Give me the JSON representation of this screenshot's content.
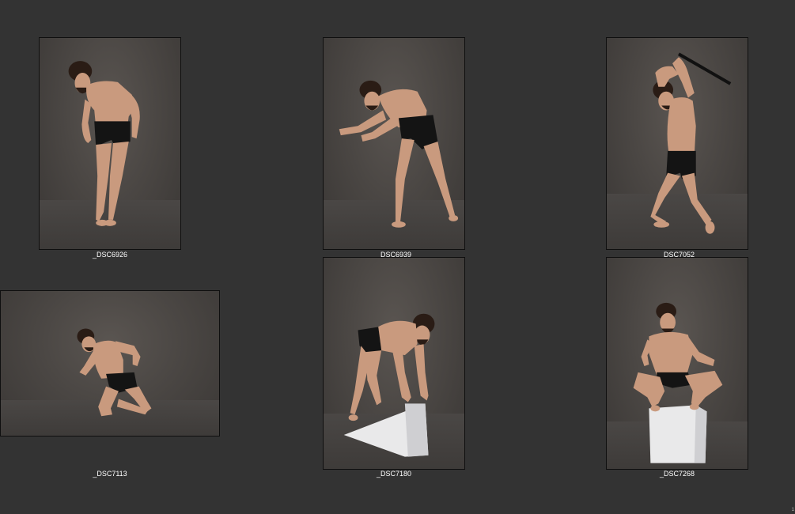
{
  "contact_sheet": {
    "photos": [
      {
        "caption": "_DSC6926",
        "subject": "man-leaning-forward-standing"
      },
      {
        "caption": "_DSC6939",
        "subject": "man-crouching-reaching-forward"
      },
      {
        "caption": "_DSC7052",
        "subject": "man-swinging-sword-overhead"
      },
      {
        "caption": "_DSC7113",
        "subject": "man-kneeling-on-one-knee"
      },
      {
        "caption": "_DSC7180",
        "subject": "man-leaning-on-white-wedge"
      },
      {
        "caption": "_DSC7268",
        "subject": "man-squatting-on-white-box"
      }
    ],
    "page_number": "1"
  }
}
